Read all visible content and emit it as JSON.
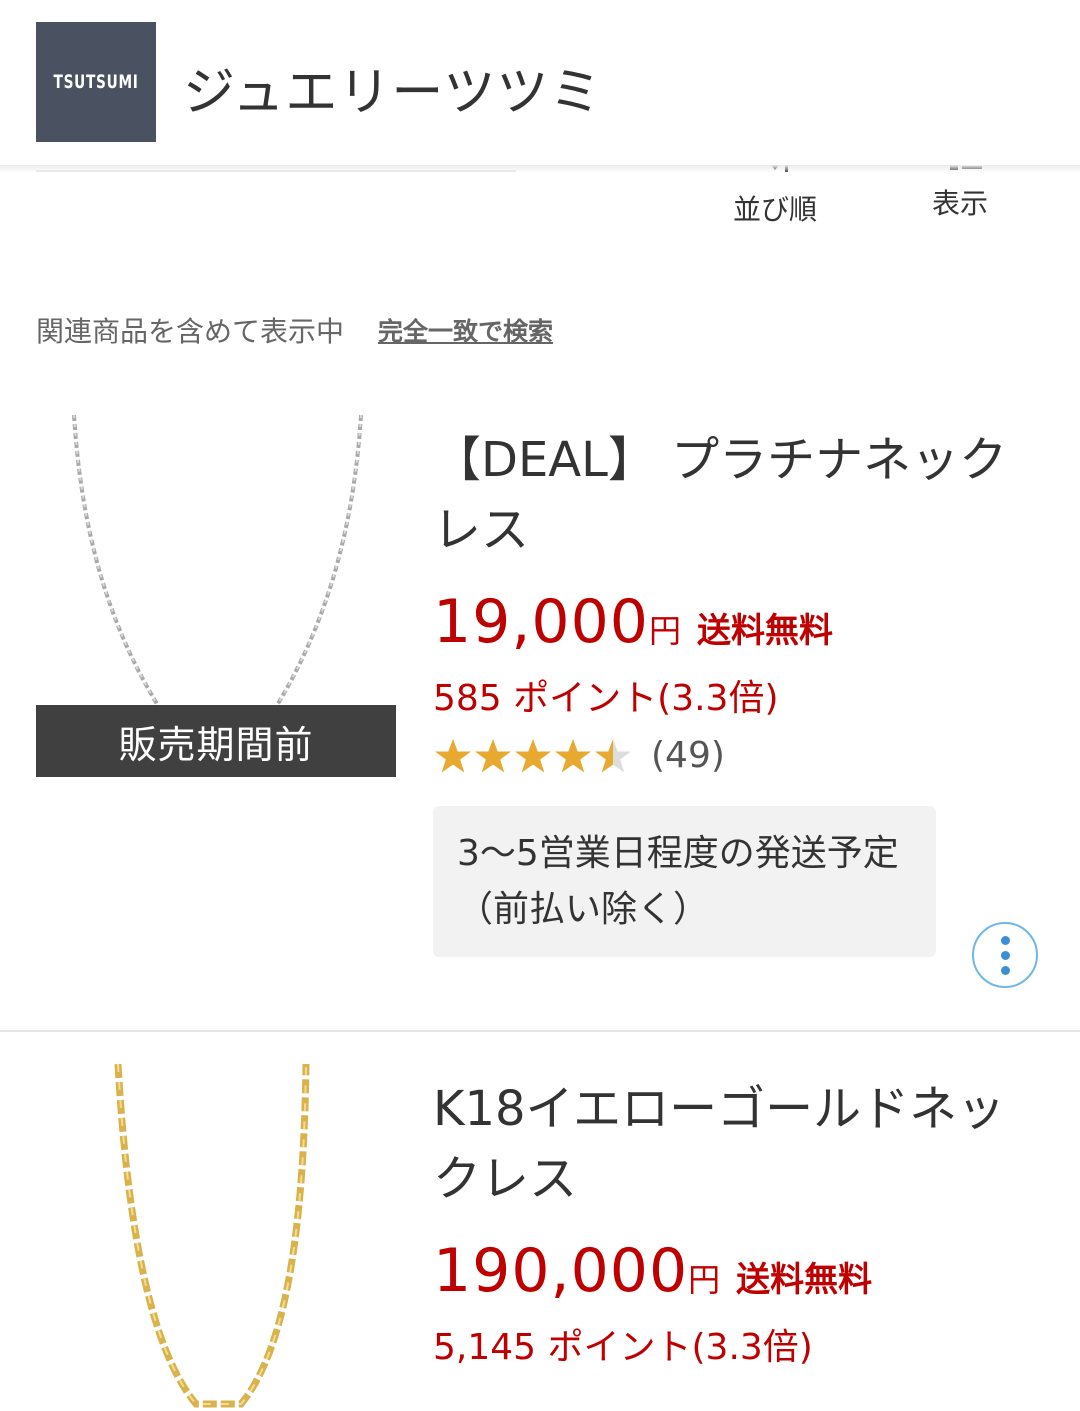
{
  "header": {
    "logo_text": "TSUTSUMI",
    "shop_name": "ジュエリーツツミ"
  },
  "toolbar": {
    "sort_label": "並び順",
    "view_label": "表示"
  },
  "related": {
    "text": "関連商品を含めて表示中",
    "exact_link": "完全一致で検索"
  },
  "products": [
    {
      "title": "【DEAL】 プラチナネックレス",
      "price": "19,000",
      "currency": "円",
      "shipping": "送料無料",
      "points": "585 ポイント(3.3倍)",
      "rating": 4.5,
      "review_count": "(49)",
      "overlay": "販売期間前",
      "shipping_note": "3〜5営業日程度の発送予定（前払い除く）"
    },
    {
      "title": "K18イエローゴールドネックレス",
      "price": "190,000",
      "currency": "円",
      "shipping": "送料無料",
      "points": "5,145 ポイント(3.3倍)"
    }
  ],
  "colors": {
    "price_red": "#bf0000",
    "star_gold": "#e8a931",
    "logo_bg": "#4a5160",
    "more_blue": "#3a8fd6"
  },
  "icons": [
    "sort-icon",
    "view-toggle-icon",
    "star-icon",
    "more-vertical-icon"
  ]
}
